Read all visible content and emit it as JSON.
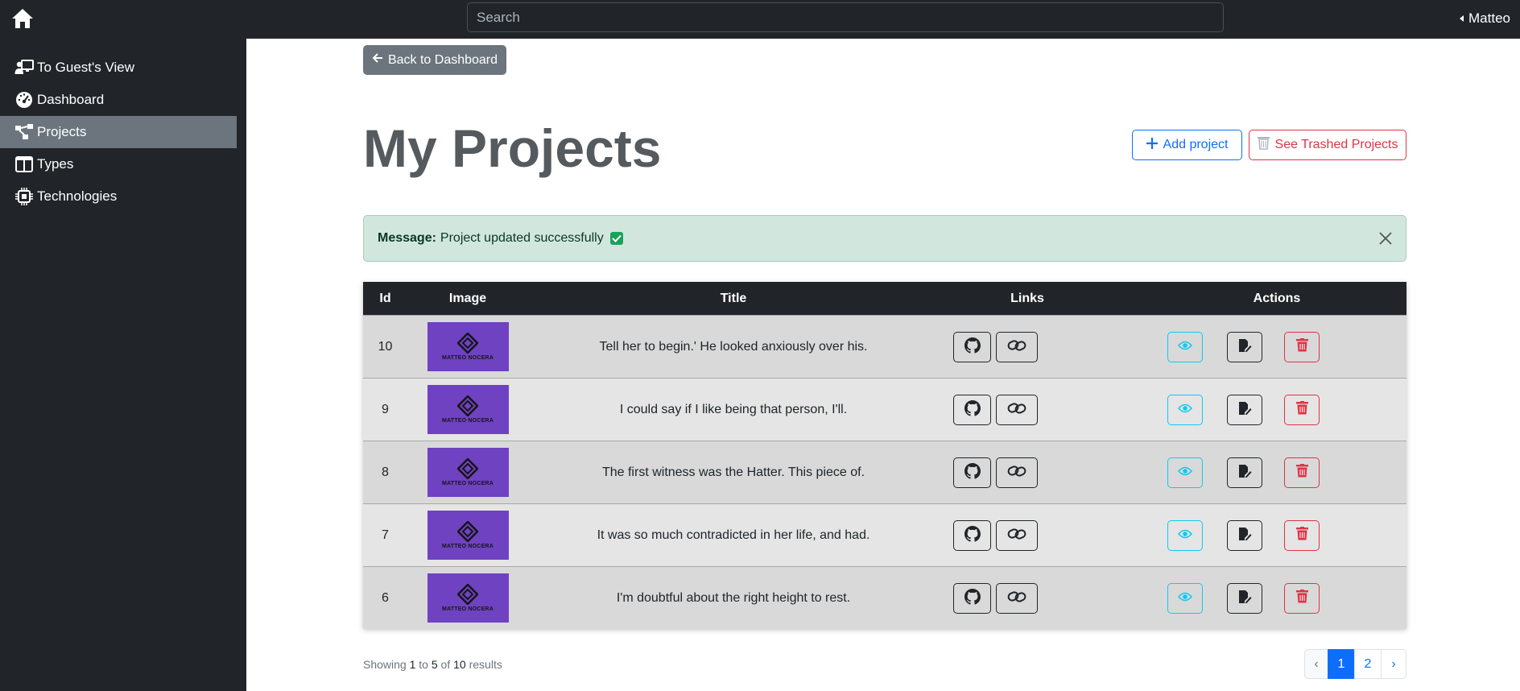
{
  "nav": {
    "search_placeholder": "Search",
    "user_name": "Matteo"
  },
  "sidebar": {
    "items": [
      {
        "label": "To Guest's View",
        "icon": "guest-view-icon",
        "active": false
      },
      {
        "label": "Dashboard",
        "icon": "dashboard-gauge-icon",
        "active": false
      },
      {
        "label": "Projects",
        "icon": "diagram-icon",
        "active": true
      },
      {
        "label": "Types",
        "icon": "layout-columns-icon",
        "active": false
      },
      {
        "label": "Technologies",
        "icon": "cpu-icon",
        "active": false
      }
    ]
  },
  "main": {
    "back_label": "Back to Dashboard",
    "title": "My Projects",
    "add_label": "Add project",
    "trash_label": "See Trashed Projects"
  },
  "alert": {
    "prefix": "Message:",
    "text": "Project updated successfully"
  },
  "table": {
    "headers": [
      "Id",
      "Image",
      "Title",
      "Links",
      "Actions"
    ],
    "thumb_label": "MATTEO NOCERA",
    "rows": [
      {
        "id": "10",
        "title": "Tell her to begin.' He looked anxiously over his."
      },
      {
        "id": "9",
        "title": "I could say if I like being that person, I'll."
      },
      {
        "id": "8",
        "title": "The first witness was the Hatter. This piece of."
      },
      {
        "id": "7",
        "title": "It was so much contradicted in her life, and had."
      },
      {
        "id": "6",
        "title": "I'm doubtful about the right height to rest."
      }
    ]
  },
  "footer": {
    "showing_prefix": "Showing",
    "from": "1",
    "to_word": "to",
    "to": "5",
    "of_word": "of",
    "total": "10",
    "results_word": "results"
  },
  "pagination": {
    "prev": "‹",
    "pages": [
      "1",
      "2"
    ],
    "current": "1",
    "next": "›"
  },
  "colors": {
    "primary": "#0d6efd",
    "danger": "#dc3545",
    "info": "#0dcaf0",
    "dark": "#212529",
    "secondary": "#6c757d",
    "success_bg": "#d1e7dd",
    "thumb_purple": "#6f42c1"
  }
}
